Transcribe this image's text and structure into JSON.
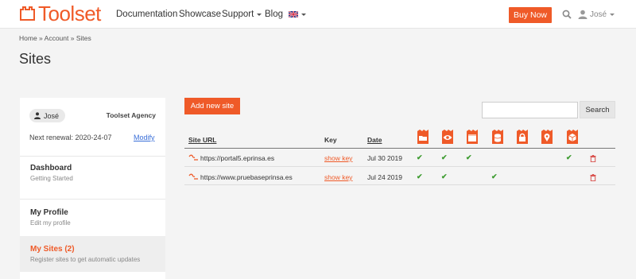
{
  "header": {
    "logo_text": "Toolset",
    "nav": [
      "Documentation",
      "Showcase",
      "Support",
      "Blog"
    ],
    "buy_now": "Buy Now",
    "user": "José",
    "brand_color": "#ef5a28"
  },
  "breadcrumb": "Home » Account » Sites",
  "page_title": "Sites",
  "sidebar": {
    "user": "José",
    "agency": "Toolset Agency",
    "renewal": "Next renewal: 2020-24-07",
    "modify": "Modify",
    "items": [
      {
        "title": "Dashboard",
        "subtitle": "Getting Started"
      },
      {
        "title": "My Profile",
        "subtitle": "Edit my profile"
      },
      {
        "title": "My Sites (2)",
        "subtitle": "Register sites to get automatic updates"
      }
    ]
  },
  "toolbar": {
    "add_site": "Add new site",
    "search_placeholder": "",
    "search_button": "Search"
  },
  "table": {
    "headers": {
      "url": "Site URL",
      "key": "Key",
      "date": "Date"
    },
    "plugin_icons": [
      "folder-icon",
      "eye-icon",
      "calendar-icon",
      "database-icon",
      "lock-icon",
      "map-marker-icon",
      "cube-icon"
    ],
    "rows": [
      {
        "url": "https://portal5.eprinsa.es",
        "key": "show key",
        "date": "Jul 30 2019",
        "checks": [
          true,
          true,
          true,
          false,
          false,
          false,
          true
        ]
      },
      {
        "url": "https://www.pruebaseprinsa.es",
        "key": "show key",
        "date": "Jul 24 2019",
        "checks": [
          true,
          true,
          false,
          true,
          false,
          false,
          false
        ]
      }
    ]
  }
}
